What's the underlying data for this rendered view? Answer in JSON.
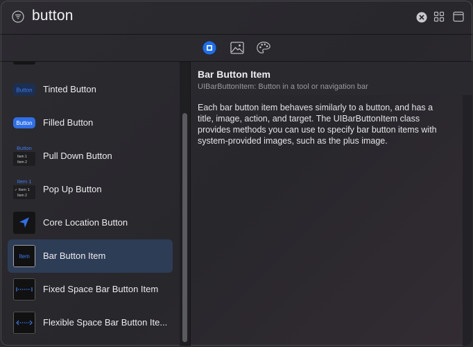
{
  "search": {
    "query": "button"
  },
  "tabs": [
    {
      "name": "objects",
      "icon": "square-circle-icon",
      "selected": true
    },
    {
      "name": "media",
      "icon": "image-icon",
      "selected": false
    },
    {
      "name": "colors",
      "icon": "palette-icon",
      "selected": false
    }
  ],
  "library": {
    "items": [
      {
        "label": "Tinted Button",
        "thumb_text": "Button"
      },
      {
        "label": "Filled Button",
        "thumb_text": "Button"
      },
      {
        "label": "Pull Down Button",
        "thumb_text": "Button",
        "thumb_items": [
          "Item 1",
          "Item 2"
        ]
      },
      {
        "label": "Pop Up Button",
        "thumb_text": "Item 1",
        "thumb_items": [
          "✓ Item 1",
          "Item 2"
        ]
      },
      {
        "label": "Core Location Button",
        "thumb_icon": "location-arrow-icon"
      },
      {
        "label": "Bar Button Item",
        "thumb_text": "Item",
        "selected": true
      },
      {
        "label": "Fixed Space Bar Button Item",
        "thumb_icon": "fixed-space-icon"
      },
      {
        "label": "Flexible Space Bar Button Ite...",
        "thumb_icon": "flexible-space-icon"
      }
    ]
  },
  "detail": {
    "title": "Bar Button Item",
    "subtitle": "UIBarButtonItem: Button in a tool or navigation bar",
    "description": "Each bar button item behaves similarly to a button, and has a title, image, action, and target. The UIBarButtonItem class provides methods you can use to specify bar button items with system-provided images, such as the plus image."
  },
  "colors": {
    "accent": "#3e7cf5",
    "selection": "#2e3d56",
    "background": "#2b2a2f"
  }
}
